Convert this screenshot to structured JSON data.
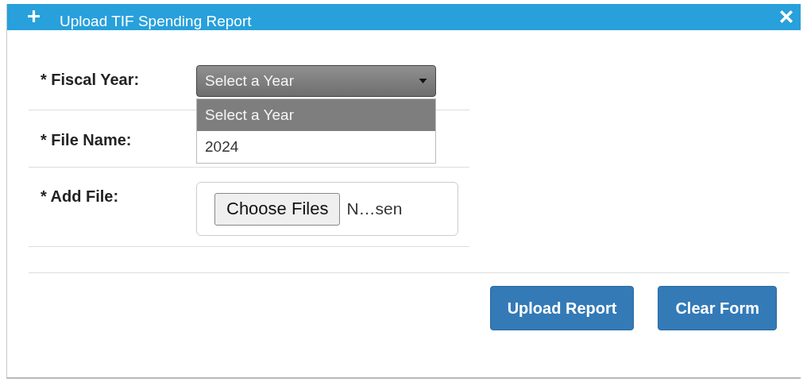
{
  "dialog": {
    "title": "Upload TIF Spending Report"
  },
  "rows": [
    {
      "label": "* Fiscal Year:",
      "control": {
        "kind": "select",
        "value": "Select a Year",
        "expanded": true,
        "options": [
          {
            "label": "Select a Year",
            "selected": true
          },
          {
            "label": "2024",
            "selected": false
          }
        ]
      }
    },
    {
      "label": "* File Name:"
    },
    {
      "label": "* Add File:",
      "control": {
        "kind": "file",
        "button": "Choose Files",
        "status": "N…sen"
      }
    }
  ],
  "buttons": [
    "Upload Report",
    "Clear Form"
  ]
}
